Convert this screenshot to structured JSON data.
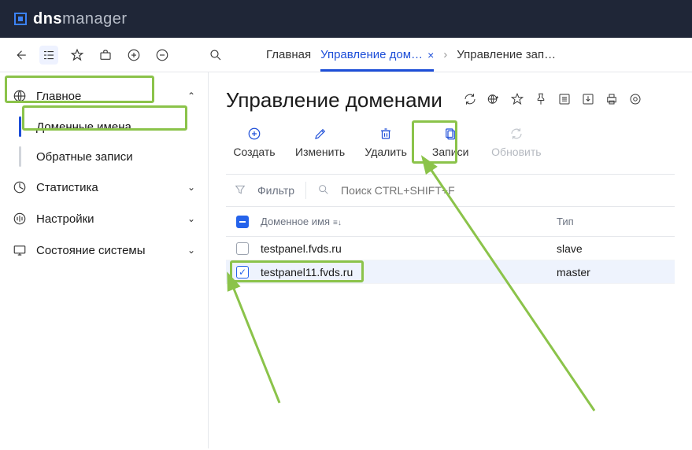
{
  "logo": {
    "bold": "dns",
    "light": "manager"
  },
  "breadcrumbs": {
    "home": "Главная",
    "active": "Управление дом…",
    "tail": "Управление зап…"
  },
  "sidebar": {
    "main": {
      "label": "Главное"
    },
    "sub": {
      "domains": "Доменные имена",
      "reverse": "Обратные записи"
    },
    "stats": "Статистика",
    "settings": "Настройки",
    "system": "Состояние системы"
  },
  "page": {
    "title": "Управление доменами"
  },
  "actions": {
    "create": "Создать",
    "edit": "Изменить",
    "delete": "Удалить",
    "records": "Записи",
    "refresh": "Обновить"
  },
  "filter": {
    "label": "Фильтр",
    "search_placeholder": "Поиск CTRL+SHIFT+F"
  },
  "table": {
    "col_name": "Доменное имя",
    "col_type": "Тип",
    "rows": [
      {
        "name": "testpanel.fvds.ru",
        "type": "slave",
        "checked": false
      },
      {
        "name": "testpanel11.fvds.ru",
        "type": "master",
        "checked": true
      }
    ]
  }
}
